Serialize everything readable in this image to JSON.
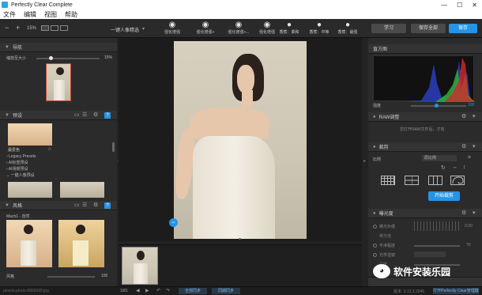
{
  "window": {
    "title": "Perfectly Clear Complete",
    "controls": [
      "—",
      "☐",
      "✕"
    ]
  },
  "menu": [
    {
      "label": "文件",
      "name": "menu-file"
    },
    {
      "label": "编辑",
      "name": "menu-edit"
    },
    {
      "label": "视图",
      "name": "menu-view"
    },
    {
      "label": "帮助",
      "name": "menu-help"
    }
  ],
  "toolbar": {
    "zoom": "15%",
    "preset_dropdown": "一键人像精选",
    "presets": [
      {
        "label": "强化增强",
        "icon": "eye-icon"
      },
      {
        "label": "强化增强+",
        "icon": "eye-icon"
      },
      {
        "label": "强化增强+...",
        "icon": "eye-icon"
      },
      {
        "label": "强化增强",
        "icon": "eye-icon"
      },
      {
        "label": "香蕉：柔和",
        "icon": "portrait-icon"
      },
      {
        "label": "香蕉：中等",
        "icon": "portrait-icon"
      },
      {
        "label": "香蕉：最强",
        "icon": "portrait-icon"
      }
    ],
    "learn_label": "学习",
    "save_as_label": "保存全部",
    "save_label": "保存"
  },
  "navigator": {
    "title": "导航",
    "zoom_label": "缩放至大小",
    "zoom_value": "15%"
  },
  "presets_panel": {
    "title": "预设",
    "favorite_label": "最爱色",
    "tree": [
      "Legacy Presets",
      "AI标签预设",
      "AI场景预设",
      "一键人像预设"
    ]
  },
  "looks_panel": {
    "title": "风格",
    "item": "Mach1 - 自然",
    "strength_label": "风格",
    "strength_value": "100"
  },
  "right": {
    "histogram_title": "直方图",
    "strength_label": "强度",
    "strength_value": "100",
    "raw_title": "RAW调整",
    "raw_desc": "您打开RAW文件后，才有",
    "crop_title": "裁剪",
    "crop_ratio_label": "比例",
    "crop_ratio_value": "原比例",
    "crop_start": "开始裁剪",
    "exposure_title": "曝光度",
    "exposure_rows": [
      {
        "label": "曝光补偿",
        "value": "0.00"
      },
      {
        "label": "曝光值",
        "value": ""
      },
      {
        "label": "平滑程度",
        "value": "70"
      },
      {
        "label": "光学透镜",
        "value": ""
      },
      {
        "label": "深度",
        "value": ""
      }
    ],
    "version": "版本: 3.12.2.2045"
  },
  "statusbar": {
    "filename": "pexels-photo-8869699.jpg",
    "index": "1/81",
    "btn_all": "全部同步",
    "btn_sync": "同期同步",
    "btn_right": "打开Perfectly Clear管理器"
  },
  "watermark": {
    "text": "软件安装乐园"
  }
}
